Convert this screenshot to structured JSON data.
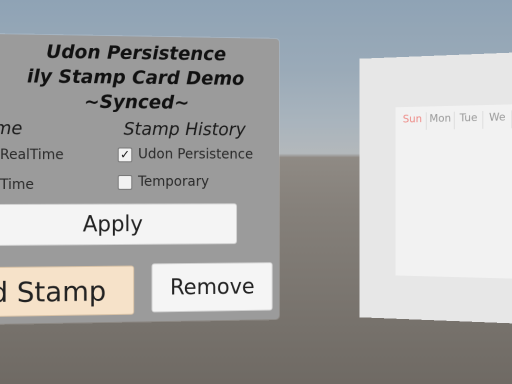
{
  "left_panel": {
    "title_line1": "Udon Persistence",
    "title_line2": "ily Stamp Card Demo",
    "title_line3": "~Synced~",
    "left_column": {
      "header": "me",
      "option1": "RealTime",
      "option2": "Time"
    },
    "right_column": {
      "header": "Stamp History",
      "option1": {
        "label": "Udon Persistence",
        "checked": true
      },
      "option2": {
        "label": "Temporary",
        "checked": false
      }
    },
    "apply_label": "Apply",
    "stamp_label": "d Stamp",
    "remove_label": "Remove"
  },
  "calendar": {
    "days": [
      "Sun",
      "Mon",
      "Tue",
      "We"
    ]
  },
  "colors": {
    "stamp_button": "#f6e2c9",
    "sunday": "#ee8a86"
  }
}
